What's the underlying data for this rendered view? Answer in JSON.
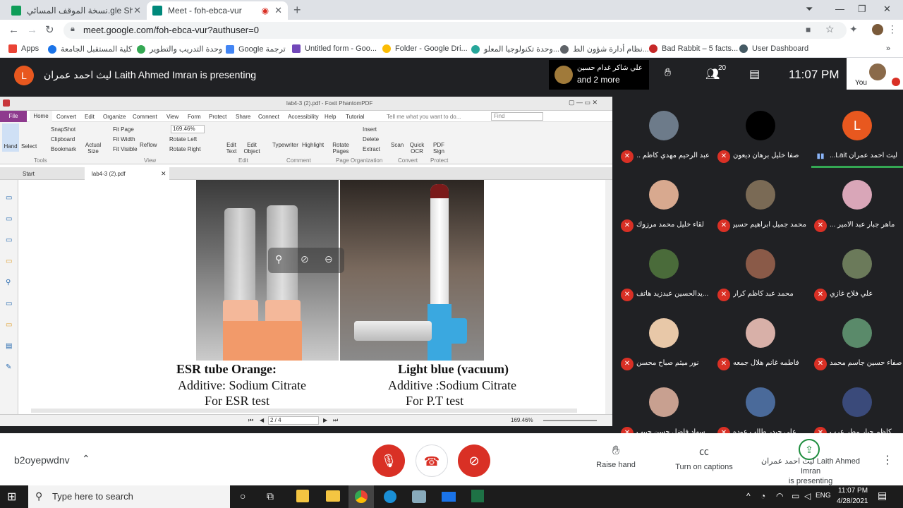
{
  "browser": {
    "tabs": [
      {
        "title": "نسخة الموقف المسائي.gle Sheets",
        "active": false,
        "color": "#0f9d58"
      },
      {
        "title": "Meet - foh-ebca-vur",
        "active": true,
        "color": "#00897b"
      }
    ],
    "url": "meet.google.com/foh-ebca-vur?authuser=0",
    "bookmarks": [
      "Apps",
      "كلية المستقبل الجامعة",
      "وحدة التدريب والتطوير",
      "Google ترجمة",
      "Untitled form - Goo...",
      "Folder - Google Dri...",
      "وحدة تكنولوجيا المعلو...",
      "نظام أدارة شؤون الط...",
      "Bad Rabbit – 5 facts...",
      "User Dashboard"
    ]
  },
  "meet": {
    "presenter_initial": "L",
    "presenter_banner": "ليث احمد عمران Laith Ahmed Imran is presenting",
    "speaker_name": "علي شاكر غدام حسين",
    "speaker_more": "and 2 more",
    "participant_count": "20",
    "time": "11:07 PM",
    "you_label": "You",
    "meeting_code": "b2oyepwdnv",
    "raise_hand": "Raise hand",
    "captions": "Turn on captions",
    "presenting_line1": "ليث احمد عمران Laith Ahmed Imran",
    "presenting_line2": "is presenting"
  },
  "participants": [
    {
      "name": "عبد الرحيم مهدي كاظم ...",
      "color": "#6d7b8a",
      "initial": "",
      "speaking": false
    },
    {
      "name": "صفا خليل برهان ديعون",
      "color": "#000000",
      "initial": "",
      "speaking": false
    },
    {
      "name": "ليث احمد عمران Lait...",
      "color": "#e8581f",
      "initial": "L",
      "speaking": true
    },
    {
      "name": "لقاء خليل محمد مرزوك",
      "color": "#d8a98f",
      "initial": "",
      "speaking": false
    },
    {
      "name": "محمد جميل ابراهيم حسين",
      "color": "#7a6a55",
      "initial": "",
      "speaking": false
    },
    {
      "name": "ماهر جبار عبد الامير ...",
      "color": "#d9a6b8",
      "initial": "",
      "speaking": false
    },
    {
      "name": "...يدالحسين عبدزيد هاتف",
      "color": "#4a6b3a",
      "initial": "",
      "speaking": false
    },
    {
      "name": "محمد عبد كاظم كرار",
      "color": "#8a5a48",
      "initial": "",
      "speaking": false
    },
    {
      "name": "علي فلاح غازي",
      "color": "#6b7a5a",
      "initial": "",
      "speaking": false
    },
    {
      "name": "نور ميثم صباح محسن",
      "color": "#e8c8a8",
      "initial": "",
      "speaking": false
    },
    {
      "name": "فاطمه غانم هلال جمعه",
      "color": "#d8b0a8",
      "initial": "",
      "speaking": false
    },
    {
      "name": "صفاء حسين جاسم محمد",
      "color": "#5a8a6a",
      "initial": "",
      "speaking": false
    },
    {
      "name": "سهاد فاضل حسن حبيب",
      "color": "#c8a090",
      "initial": "",
      "speaking": false
    },
    {
      "name": "علي حيدر طالب عوده",
      "color": "#4a6a9a",
      "initial": "",
      "speaking": false
    },
    {
      "name": "كاظم جبار مطر عرب",
      "color": "#3a4a7a",
      "initial": "",
      "speaking": false
    }
  ],
  "pdf": {
    "title": "lab4-3 (2).pdf - Foxit PhantomPDF",
    "menu": [
      "File",
      "Home",
      "Convert",
      "Edit",
      "Organize",
      "Comment",
      "View",
      "Form",
      "Protect",
      "Share",
      "Connect",
      "Accessibility",
      "Help",
      "Tutorial"
    ],
    "tell_me": "Tell me what you want to do...",
    "find": "Find",
    "zoom": "169.46%",
    "tools": {
      "hand": "Hand",
      "select": "Select",
      "snapshot": "SnapShot",
      "clipboard": "Clipboard",
      "bookmark": "Bookmark",
      "actual": "Actual Size",
      "fitpage": "Fit Page",
      "fitwidth": "Fit Width",
      "fitvisible": "Fit Visible",
      "reflow": "Reflow",
      "rotleft": "Rotate Left",
      "rotright": "Rotate Right",
      "edittext": "Edit Text",
      "editobj": "Edit Object",
      "typewriter": "Typewriter",
      "highlight": "Highlight",
      "rotpages": "Rotate Pages",
      "insert": "Insert",
      "delete": "Delete",
      "extract": "Extract",
      "scan": "Scan",
      "ocr": "Quick OCR",
      "sign": "PDF Sign"
    },
    "groups": [
      "Tools",
      "View",
      "Edit",
      "Comment",
      "Page Organization",
      "Convert",
      "Protect"
    ],
    "doc_tabs": [
      "Start",
      "lab4-3 (2).pdf"
    ],
    "page_indicator": "2 / 4",
    "bottom_zoom": "169.46%",
    "left_caption": [
      "ESR tube    Orange:",
      "Additive: Sodium Citrate",
      "For ESR test"
    ],
    "right_caption": [
      "Light blue (vacuum)",
      "Additive :Sodium Citrate",
      "For P.T test"
    ]
  },
  "taskbar": {
    "search": "Type here to search",
    "lang": "ENG",
    "time": "11:07 PM",
    "date": "4/28/2021"
  }
}
